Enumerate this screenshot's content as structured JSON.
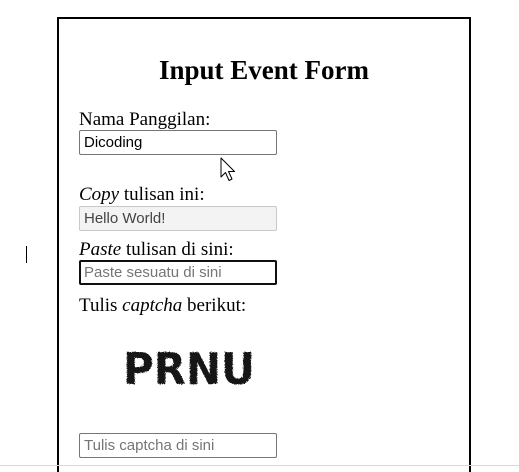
{
  "form": {
    "title": "Input Event Form",
    "nickname": {
      "label": "Nama Panggilan:",
      "value": "Dicoding"
    },
    "copy": {
      "label_em": "Copy",
      "label_rest": " tulisan ini:",
      "value": "Hello World!"
    },
    "paste": {
      "label_em": "Paste",
      "label_rest": " tulisan di sini:",
      "placeholder": "Paste sesuatu di sini"
    },
    "captcha": {
      "label_pre": "Tulis ",
      "label_em": "captcha",
      "label_post": " berikut:",
      "image_text": "PRNU",
      "placeholder": "Tulis captcha di sini"
    }
  },
  "cursor": {
    "icon": "arrow-pointer-icon"
  }
}
